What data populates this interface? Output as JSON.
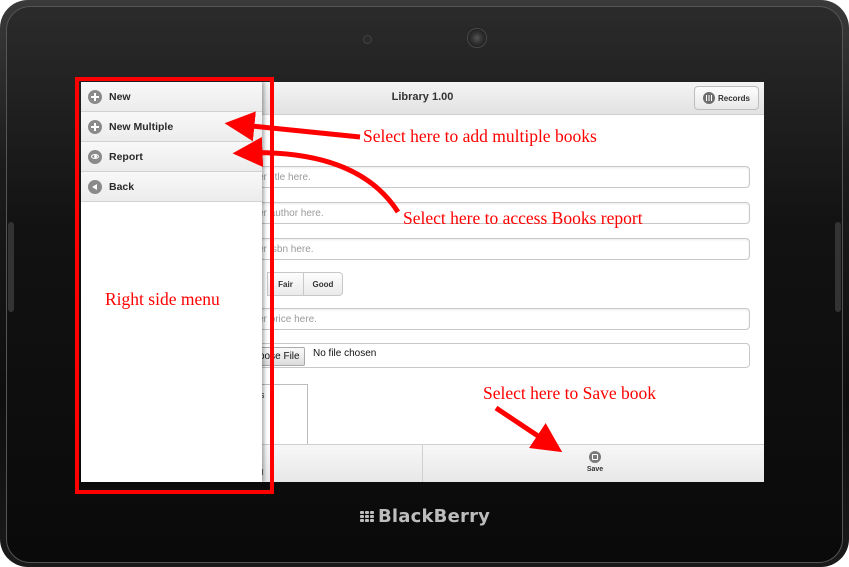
{
  "device": {
    "brand_logo_text": "BlackBerry"
  },
  "app": {
    "title": "Library 1.00",
    "records_button": "Records",
    "fields": {
      "title_placeholder": "er title here.",
      "author_placeholder": "er author here.",
      "isbn_placeholder": "er isbn here.",
      "price_placeholder": "er price here."
    },
    "condition_options": [
      "Fair",
      "Good"
    ],
    "file_input": {
      "button_label": "oose File",
      "status": "No file chosen"
    },
    "image_box_text": "s",
    "footer": {
      "left_label": "ol",
      "save_label": "Save"
    }
  },
  "side_menu": {
    "items": [
      {
        "label": "New",
        "icon": "plus-circle-icon"
      },
      {
        "label": "New Multiple",
        "icon": "plus-circle-icon"
      },
      {
        "label": "Report",
        "icon": "eye-icon"
      },
      {
        "label": "Back",
        "icon": "back-arrow-icon"
      }
    ]
  },
  "annotations": {
    "side_menu_label": "Right side menu",
    "new_multiple_note": "Select here to add multiple books",
    "report_note": "Select here to access Books report",
    "save_note": "Select here to Save book",
    "color": "#ff0000"
  }
}
